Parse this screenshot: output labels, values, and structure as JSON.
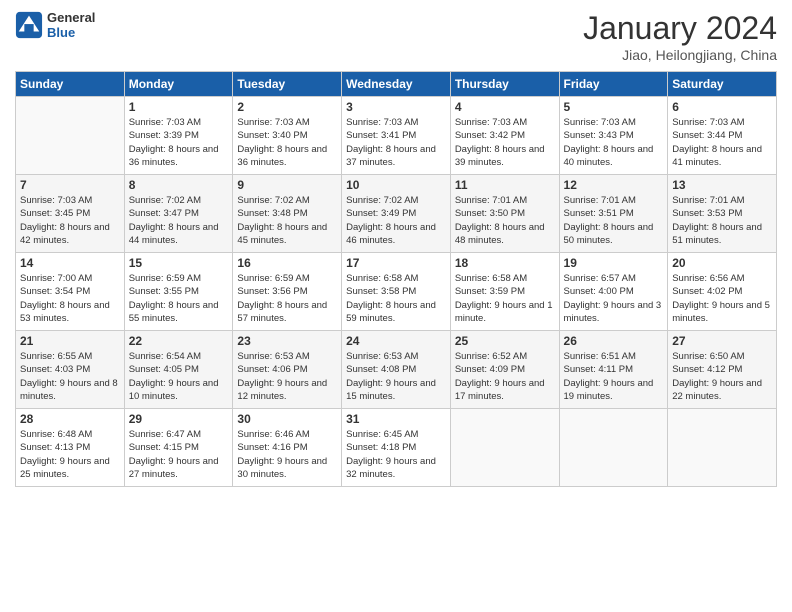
{
  "header": {
    "logo": {
      "general": "General",
      "blue": "Blue"
    },
    "title": "January 2024",
    "location": "Jiao, Heilongjiang, China"
  },
  "weekdays": [
    "Sunday",
    "Monday",
    "Tuesday",
    "Wednesday",
    "Thursday",
    "Friday",
    "Saturday"
  ],
  "weeks": [
    [
      {
        "day": "",
        "sunrise": "",
        "sunset": "",
        "daylight": ""
      },
      {
        "day": "1",
        "sunrise": "Sunrise: 7:03 AM",
        "sunset": "Sunset: 3:39 PM",
        "daylight": "Daylight: 8 hours and 36 minutes."
      },
      {
        "day": "2",
        "sunrise": "Sunrise: 7:03 AM",
        "sunset": "Sunset: 3:40 PM",
        "daylight": "Daylight: 8 hours and 36 minutes."
      },
      {
        "day": "3",
        "sunrise": "Sunrise: 7:03 AM",
        "sunset": "Sunset: 3:41 PM",
        "daylight": "Daylight: 8 hours and 37 minutes."
      },
      {
        "day": "4",
        "sunrise": "Sunrise: 7:03 AM",
        "sunset": "Sunset: 3:42 PM",
        "daylight": "Daylight: 8 hours and 39 minutes."
      },
      {
        "day": "5",
        "sunrise": "Sunrise: 7:03 AM",
        "sunset": "Sunset: 3:43 PM",
        "daylight": "Daylight: 8 hours and 40 minutes."
      },
      {
        "day": "6",
        "sunrise": "Sunrise: 7:03 AM",
        "sunset": "Sunset: 3:44 PM",
        "daylight": "Daylight: 8 hours and 41 minutes."
      }
    ],
    [
      {
        "day": "7",
        "sunrise": "Sunrise: 7:03 AM",
        "sunset": "Sunset: 3:45 PM",
        "daylight": "Daylight: 8 hours and 42 minutes."
      },
      {
        "day": "8",
        "sunrise": "Sunrise: 7:02 AM",
        "sunset": "Sunset: 3:47 PM",
        "daylight": "Daylight: 8 hours and 44 minutes."
      },
      {
        "day": "9",
        "sunrise": "Sunrise: 7:02 AM",
        "sunset": "Sunset: 3:48 PM",
        "daylight": "Daylight: 8 hours and 45 minutes."
      },
      {
        "day": "10",
        "sunrise": "Sunrise: 7:02 AM",
        "sunset": "Sunset: 3:49 PM",
        "daylight": "Daylight: 8 hours and 46 minutes."
      },
      {
        "day": "11",
        "sunrise": "Sunrise: 7:01 AM",
        "sunset": "Sunset: 3:50 PM",
        "daylight": "Daylight: 8 hours and 48 minutes."
      },
      {
        "day": "12",
        "sunrise": "Sunrise: 7:01 AM",
        "sunset": "Sunset: 3:51 PM",
        "daylight": "Daylight: 8 hours and 50 minutes."
      },
      {
        "day": "13",
        "sunrise": "Sunrise: 7:01 AM",
        "sunset": "Sunset: 3:53 PM",
        "daylight": "Daylight: 8 hours and 51 minutes."
      }
    ],
    [
      {
        "day": "14",
        "sunrise": "Sunrise: 7:00 AM",
        "sunset": "Sunset: 3:54 PM",
        "daylight": "Daylight: 8 hours and 53 minutes."
      },
      {
        "day": "15",
        "sunrise": "Sunrise: 6:59 AM",
        "sunset": "Sunset: 3:55 PM",
        "daylight": "Daylight: 8 hours and 55 minutes."
      },
      {
        "day": "16",
        "sunrise": "Sunrise: 6:59 AM",
        "sunset": "Sunset: 3:56 PM",
        "daylight": "Daylight: 8 hours and 57 minutes."
      },
      {
        "day": "17",
        "sunrise": "Sunrise: 6:58 AM",
        "sunset": "Sunset: 3:58 PM",
        "daylight": "Daylight: 8 hours and 59 minutes."
      },
      {
        "day": "18",
        "sunrise": "Sunrise: 6:58 AM",
        "sunset": "Sunset: 3:59 PM",
        "daylight": "Daylight: 9 hours and 1 minute."
      },
      {
        "day": "19",
        "sunrise": "Sunrise: 6:57 AM",
        "sunset": "Sunset: 4:00 PM",
        "daylight": "Daylight: 9 hours and 3 minutes."
      },
      {
        "day": "20",
        "sunrise": "Sunrise: 6:56 AM",
        "sunset": "Sunset: 4:02 PM",
        "daylight": "Daylight: 9 hours and 5 minutes."
      }
    ],
    [
      {
        "day": "21",
        "sunrise": "Sunrise: 6:55 AM",
        "sunset": "Sunset: 4:03 PM",
        "daylight": "Daylight: 9 hours and 8 minutes."
      },
      {
        "day": "22",
        "sunrise": "Sunrise: 6:54 AM",
        "sunset": "Sunset: 4:05 PM",
        "daylight": "Daylight: 9 hours and 10 minutes."
      },
      {
        "day": "23",
        "sunrise": "Sunrise: 6:53 AM",
        "sunset": "Sunset: 4:06 PM",
        "daylight": "Daylight: 9 hours and 12 minutes."
      },
      {
        "day": "24",
        "sunrise": "Sunrise: 6:53 AM",
        "sunset": "Sunset: 4:08 PM",
        "daylight": "Daylight: 9 hours and 15 minutes."
      },
      {
        "day": "25",
        "sunrise": "Sunrise: 6:52 AM",
        "sunset": "Sunset: 4:09 PM",
        "daylight": "Daylight: 9 hours and 17 minutes."
      },
      {
        "day": "26",
        "sunrise": "Sunrise: 6:51 AM",
        "sunset": "Sunset: 4:11 PM",
        "daylight": "Daylight: 9 hours and 19 minutes."
      },
      {
        "day": "27",
        "sunrise": "Sunrise: 6:50 AM",
        "sunset": "Sunset: 4:12 PM",
        "daylight": "Daylight: 9 hours and 22 minutes."
      }
    ],
    [
      {
        "day": "28",
        "sunrise": "Sunrise: 6:48 AM",
        "sunset": "Sunset: 4:13 PM",
        "daylight": "Daylight: 9 hours and 25 minutes."
      },
      {
        "day": "29",
        "sunrise": "Sunrise: 6:47 AM",
        "sunset": "Sunset: 4:15 PM",
        "daylight": "Daylight: 9 hours and 27 minutes."
      },
      {
        "day": "30",
        "sunrise": "Sunrise: 6:46 AM",
        "sunset": "Sunset: 4:16 PM",
        "daylight": "Daylight: 9 hours and 30 minutes."
      },
      {
        "day": "31",
        "sunrise": "Sunrise: 6:45 AM",
        "sunset": "Sunset: 4:18 PM",
        "daylight": "Daylight: 9 hours and 32 minutes."
      },
      {
        "day": "",
        "sunrise": "",
        "sunset": "",
        "daylight": ""
      },
      {
        "day": "",
        "sunrise": "",
        "sunset": "",
        "daylight": ""
      },
      {
        "day": "",
        "sunrise": "",
        "sunset": "",
        "daylight": ""
      }
    ]
  ]
}
